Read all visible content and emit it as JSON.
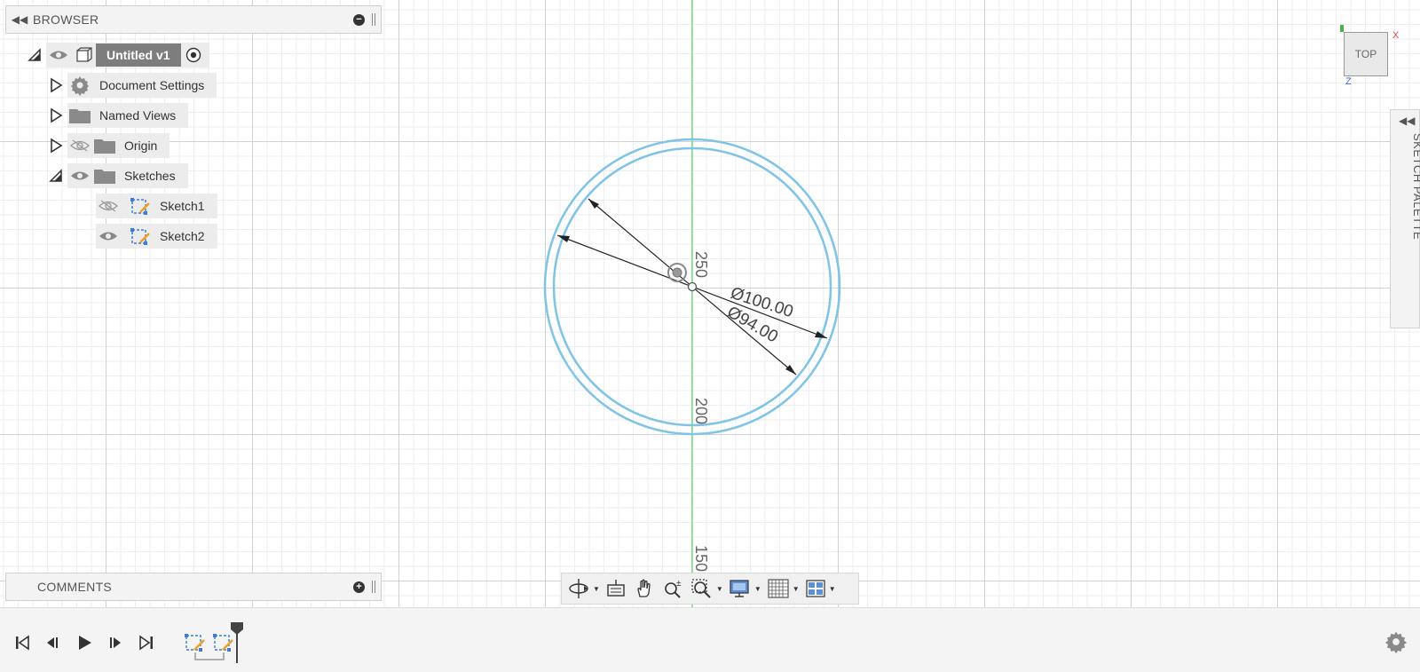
{
  "browser": {
    "title": "BROWSER",
    "collapse_icon": "double-chevron-left-icon",
    "root": {
      "label": "Untitled v1"
    },
    "items": [
      {
        "label": "Document Settings",
        "icon": "gear-icon"
      },
      {
        "label": "Named Views",
        "icon": "folder-icon"
      },
      {
        "label": "Origin",
        "icon": "folder-icon",
        "hidden": true
      },
      {
        "label": "Sketches",
        "icon": "folder-icon"
      },
      {
        "label": "Sketch1",
        "icon": "sketch-icon",
        "hidden": true
      },
      {
        "label": "Sketch2",
        "icon": "sketch-icon"
      }
    ]
  },
  "comments": {
    "title": "COMMENTS"
  },
  "viewcube": {
    "face": "TOP",
    "axis_x": "X",
    "axis_z": "Z"
  },
  "sketch_palette": {
    "title": "SKETCH PALETTE"
  },
  "sketch": {
    "dimension_outer": "Ø100.00",
    "dimension_inner": "Ø94.00",
    "ruler_labels": [
      "250",
      "200",
      "150"
    ]
  },
  "colors": {
    "circle": "#7fc3e6",
    "y_axis": "#66dd66",
    "panel_bg": "#f3f3f3",
    "root_label_bg": "#7d7d7d"
  }
}
